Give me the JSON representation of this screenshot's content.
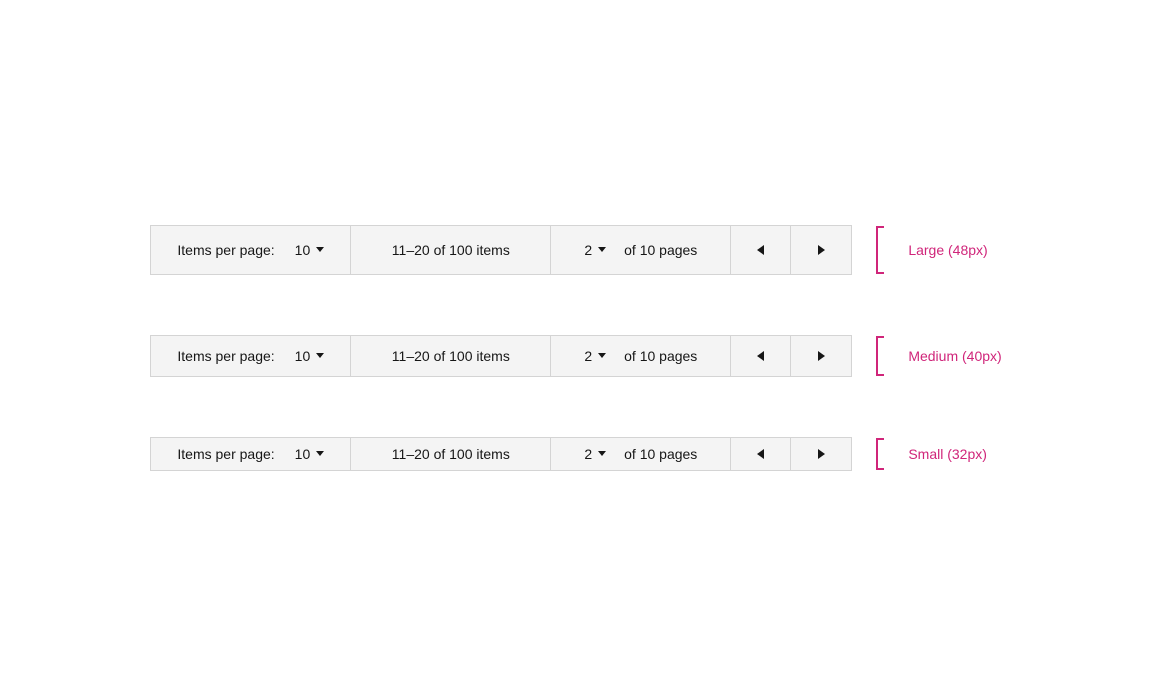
{
  "paginators": [
    {
      "id": "large",
      "size_class": "large",
      "height": 48,
      "items_per_page_label": "Items per page:",
      "items_per_page_value": "10",
      "item_range": "11–20 of 100 items",
      "page_value": "2",
      "page_suffix": "of 10 pages",
      "size_label": "Large (48px)"
    },
    {
      "id": "medium",
      "size_class": "medium",
      "height": 40,
      "items_per_page_label": "Items per page:",
      "items_per_page_value": "10",
      "item_range": "11–20 of 100 items",
      "page_value": "2",
      "page_suffix": "of 10 pages",
      "size_label": "Medium (40px)"
    },
    {
      "id": "small",
      "size_class": "small",
      "height": 32,
      "items_per_page_label": "Items per page:",
      "items_per_page_value": "10",
      "item_range": "11–20 of 100 items",
      "page_value": "2",
      "page_suffix": "of 10 pages",
      "size_label": "Small (32px)"
    }
  ]
}
